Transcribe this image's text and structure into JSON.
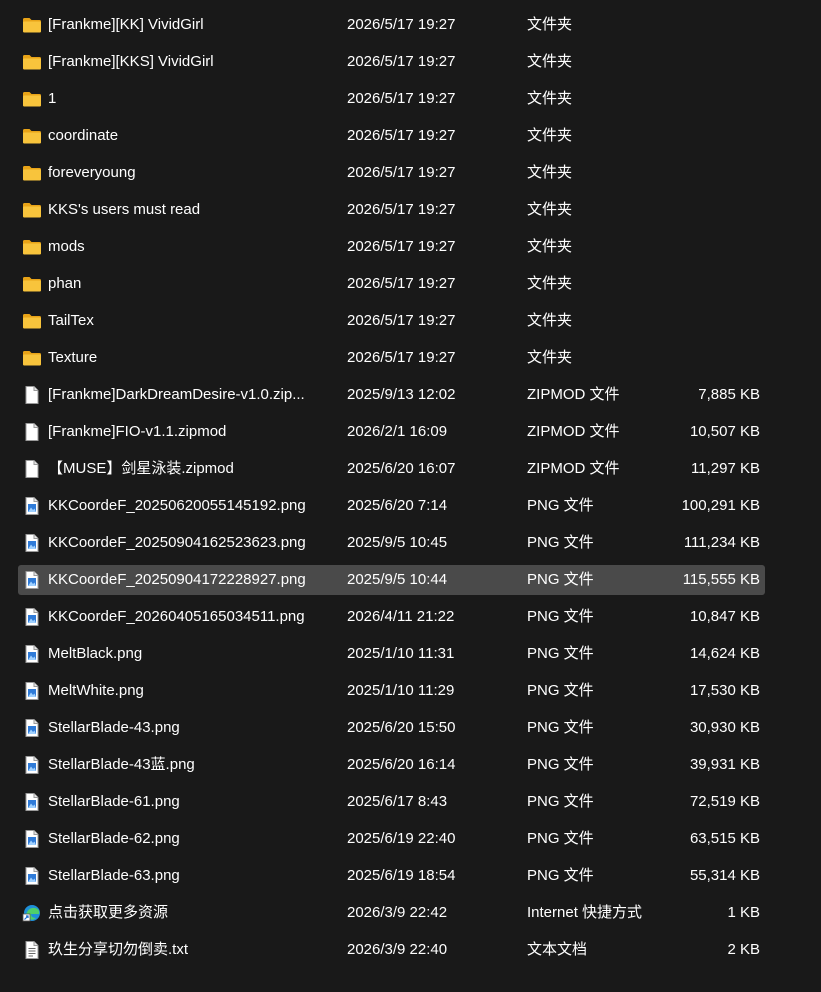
{
  "colors": {
    "background": "#191919",
    "text": "#ffffff",
    "selected_row": "#4a4a4a",
    "folder": "#f8c43c",
    "image_accent": "#2f7bd8"
  },
  "files": [
    {
      "name": "[Frankme][KK] VividGirl",
      "date": "2026/5/17 19:27",
      "type": "文件夹",
      "size": "",
      "icon": "folder-icon",
      "selected": false
    },
    {
      "name": "[Frankme][KKS] VividGirl",
      "date": "2026/5/17 19:27",
      "type": "文件夹",
      "size": "",
      "icon": "folder-icon",
      "selected": false
    },
    {
      "name": "1",
      "date": "2026/5/17 19:27",
      "type": "文件夹",
      "size": "",
      "icon": "folder-icon",
      "selected": false
    },
    {
      "name": "coordinate",
      "date": "2026/5/17 19:27",
      "type": "文件夹",
      "size": "",
      "icon": "folder-icon",
      "selected": false
    },
    {
      "name": "foreveryoung",
      "date": "2026/5/17 19:27",
      "type": "文件夹",
      "size": "",
      "icon": "folder-icon",
      "selected": false
    },
    {
      "name": "KKS's users must read",
      "date": "2026/5/17 19:27",
      "type": "文件夹",
      "size": "",
      "icon": "folder-icon",
      "selected": false
    },
    {
      "name": "mods",
      "date": "2026/5/17 19:27",
      "type": "文件夹",
      "size": "",
      "icon": "folder-icon",
      "selected": false
    },
    {
      "name": "phan",
      "date": "2026/5/17 19:27",
      "type": "文件夹",
      "size": "",
      "icon": "folder-icon",
      "selected": false
    },
    {
      "name": "TailTex",
      "date": "2026/5/17 19:27",
      "type": "文件夹",
      "size": "",
      "icon": "folder-icon",
      "selected": false
    },
    {
      "name": "Texture",
      "date": "2026/5/17 19:27",
      "type": "文件夹",
      "size": "",
      "icon": "folder-icon",
      "selected": false
    },
    {
      "name": "[Frankme]DarkDreamDesire-v1.0.zip...",
      "date": "2025/9/13 12:02",
      "type": "ZIPMOD 文件",
      "size": "7,885 KB",
      "icon": "file-icon",
      "selected": false
    },
    {
      "name": "[Frankme]FIO-v1.1.zipmod",
      "date": "2026/2/1 16:09",
      "type": "ZIPMOD 文件",
      "size": "10,507 KB",
      "icon": "file-icon",
      "selected": false
    },
    {
      "name": "【MUSE】剑星泳装.zipmod",
      "date": "2025/6/20 16:07",
      "type": "ZIPMOD 文件",
      "size": "11,297 KB",
      "icon": "file-icon",
      "selected": false
    },
    {
      "name": "KKCoordeF_20250620055145192.png",
      "date": "2025/6/20 7:14",
      "type": "PNG 文件",
      "size": "100,291 KB",
      "icon": "image-file-icon",
      "selected": false
    },
    {
      "name": "KKCoordeF_20250904162523623.png",
      "date": "2025/9/5 10:45",
      "type": "PNG 文件",
      "size": "111,234 KB",
      "icon": "image-file-icon",
      "selected": false
    },
    {
      "name": "KKCoordeF_20250904172228927.png",
      "date": "2025/9/5 10:44",
      "type": "PNG 文件",
      "size": "115,555 KB",
      "icon": "image-file-icon",
      "selected": true
    },
    {
      "name": "KKCoordeF_20260405165034511.png",
      "date": "2026/4/11 21:22",
      "type": "PNG 文件",
      "size": "10,847 KB",
      "icon": "image-file-icon",
      "selected": false
    },
    {
      "name": "MeltBlack.png",
      "date": "2025/1/10 11:31",
      "type": "PNG 文件",
      "size": "14,624 KB",
      "icon": "image-file-icon",
      "selected": false
    },
    {
      "name": "MeltWhite.png",
      "date": "2025/1/10 11:29",
      "type": "PNG 文件",
      "size": "17,530 KB",
      "icon": "image-file-icon",
      "selected": false
    },
    {
      "name": "StellarBlade-43.png",
      "date": "2025/6/20 15:50",
      "type": "PNG 文件",
      "size": "30,930 KB",
      "icon": "image-file-icon",
      "selected": false
    },
    {
      "name": "StellarBlade-43蓝.png",
      "date": "2025/6/20 16:14",
      "type": "PNG 文件",
      "size": "39,931 KB",
      "icon": "image-file-icon",
      "selected": false
    },
    {
      "name": "StellarBlade-61.png",
      "date": "2025/6/17 8:43",
      "type": "PNG 文件",
      "size": "72,519 KB",
      "icon": "image-file-icon",
      "selected": false
    },
    {
      "name": "StellarBlade-62.png",
      "date": "2025/6/19 22:40",
      "type": "PNG 文件",
      "size": "63,515 KB",
      "icon": "image-file-icon",
      "selected": false
    },
    {
      "name": "StellarBlade-63.png",
      "date": "2025/6/19 18:54",
      "type": "PNG 文件",
      "size": "55,314 KB",
      "icon": "image-file-icon",
      "selected": false
    },
    {
      "name": "点击获取更多资源",
      "date": "2026/3/9 22:42",
      "type": "Internet 快捷方式",
      "size": "1 KB",
      "icon": "edge-shortcut-icon",
      "selected": false
    },
    {
      "name": "玖生分享切勿倒卖.txt",
      "date": "2026/3/9 22:40",
      "type": "文本文档",
      "size": "2 KB",
      "icon": "text-file-icon",
      "selected": false
    }
  ]
}
